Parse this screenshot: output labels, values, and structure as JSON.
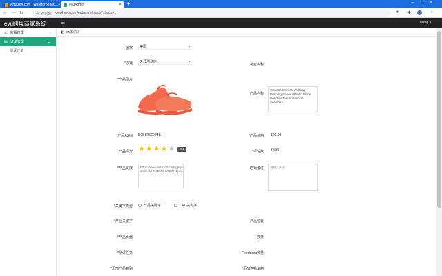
{
  "browser": {
    "tabs": [
      {
        "label": "Amazon.com | Waterdrop Mo...",
        "active": false
      },
      {
        "label": "eyuAdmin",
        "active": true
      }
    ],
    "url_security": "不安全",
    "url": "dev4.eyu.com/ord/store/batch?status=1"
  },
  "app": {
    "brand": "eyu跨境商家系统",
    "user": "wang"
  },
  "sidebar": {
    "items": [
      {
        "label": "店铺管理",
        "active": false
      },
      {
        "label": "订单管理",
        "active": true
      }
    ],
    "sub_items": [
      "测评订单"
    ]
  },
  "breadcrumb": "添加测评",
  "form": {
    "country": {
      "label": "国家",
      "value": "美国"
    },
    "store": {
      "label": "*店铺",
      "value": "天涯测测店"
    },
    "site_category": {
      "label": "类目名称",
      "value": ""
    },
    "product_image": {
      "label": "*产品图片"
    },
    "product_name": {
      "label": "产品名称",
      "value": "Wairoon Women Walking Running Shoes Athletic Blade Non Slip Tennis Fashion Sneakers"
    },
    "asin": {
      "label": "*产品ASIN",
      "value": "B0B8F5GXMS"
    },
    "price": {
      "label": "*产品价格",
      "value": "$29.99"
    },
    "rating": {
      "label": "产品评分",
      "value": "4.4",
      "stars_filled": 4,
      "stars_total": 5
    },
    "review_count": {
      "label": "*评论数",
      "value": "7,635"
    },
    "link": {
      "label": "*产品链接",
      "value": "https://www.amazon.com/gp/product/B0B8F5GXMS/ref=ox_sc_act_title_1?smid=A2PH8R0NXGFWJ&psc=1&th=1&dp_title_ms_kc"
    },
    "remark": {
      "label": "店铺备注",
      "placeholder": "请输入内容"
    },
    "keyword_type": {
      "label": "*关键字类型",
      "options": [
        "产品关键字",
        "CPC关键字"
      ]
    },
    "keywords": {
      "label": "*产品关键字",
      "value": ""
    },
    "product_position": {
      "label": "产品位置",
      "value": ""
    },
    "product_page": {
      "label": "*产品页面",
      "value": ""
    },
    "quantity": {
      "label": "数量",
      "value": ""
    },
    "review_type": {
      "label": "*测评任务",
      "value": ""
    },
    "feedback": {
      "label": "Feedback数量",
      "value": ""
    },
    "brand_bidding": {
      "label": "*添加产品到购",
      "value": ""
    },
    "cart_bidding": {
      "label": "*添加购物车的",
      "value": ""
    }
  },
  "colors": {
    "accent": "#1fa67a",
    "topbar": "#222222",
    "browser_blue": "#1d6fe0",
    "shoe": "#f2694d",
    "star": "#f2c200"
  }
}
